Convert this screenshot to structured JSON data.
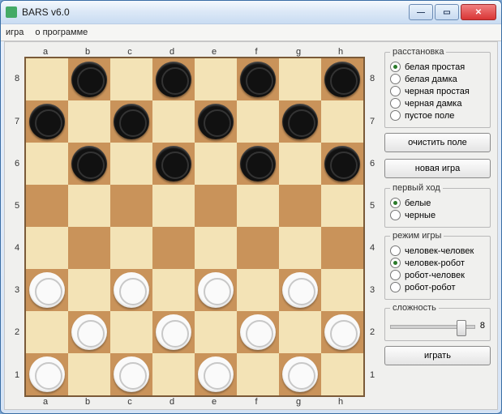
{
  "window": {
    "title": "BARS v6.0"
  },
  "menu": {
    "game": "игра",
    "about": "о программе"
  },
  "board": {
    "files": [
      "a",
      "b",
      "c",
      "d",
      "e",
      "f",
      "g",
      "h"
    ],
    "ranks": [
      "8",
      "7",
      "6",
      "5",
      "4",
      "3",
      "2",
      "1"
    ],
    "pieces": [
      {
        "r": 0,
        "c": 1,
        "color": "black"
      },
      {
        "r": 0,
        "c": 3,
        "color": "black"
      },
      {
        "r": 0,
        "c": 5,
        "color": "black"
      },
      {
        "r": 0,
        "c": 7,
        "color": "black"
      },
      {
        "r": 1,
        "c": 0,
        "color": "black"
      },
      {
        "r": 1,
        "c": 2,
        "color": "black"
      },
      {
        "r": 1,
        "c": 4,
        "color": "black"
      },
      {
        "r": 1,
        "c": 6,
        "color": "black"
      },
      {
        "r": 2,
        "c": 1,
        "color": "black"
      },
      {
        "r": 2,
        "c": 3,
        "color": "black"
      },
      {
        "r": 2,
        "c": 5,
        "color": "black"
      },
      {
        "r": 2,
        "c": 7,
        "color": "black"
      },
      {
        "r": 5,
        "c": 0,
        "color": "white"
      },
      {
        "r": 5,
        "c": 2,
        "color": "white"
      },
      {
        "r": 5,
        "c": 4,
        "color": "white"
      },
      {
        "r": 5,
        "c": 6,
        "color": "white"
      },
      {
        "r": 6,
        "c": 1,
        "color": "white"
      },
      {
        "r": 6,
        "c": 3,
        "color": "white"
      },
      {
        "r": 6,
        "c": 5,
        "color": "white"
      },
      {
        "r": 6,
        "c": 7,
        "color": "white"
      },
      {
        "r": 7,
        "c": 0,
        "color": "white"
      },
      {
        "r": 7,
        "c": 2,
        "color": "white"
      },
      {
        "r": 7,
        "c": 4,
        "color": "white"
      },
      {
        "r": 7,
        "c": 6,
        "color": "white"
      }
    ]
  },
  "setup": {
    "legend": "расстановка",
    "options": [
      {
        "label": "белая простая",
        "checked": true
      },
      {
        "label": "белая дамка",
        "checked": false
      },
      {
        "label": "черная простая",
        "checked": false
      },
      {
        "label": "черная дамка",
        "checked": false
      },
      {
        "label": "пустое поле",
        "checked": false
      }
    ]
  },
  "buttons": {
    "clear": "очистить поле",
    "newgame": "новая игра",
    "play": "играть"
  },
  "firstmove": {
    "legend": "первый ход",
    "options": [
      {
        "label": "белые",
        "checked": true
      },
      {
        "label": "черные",
        "checked": false
      }
    ]
  },
  "mode": {
    "legend": "режим игры",
    "options": [
      {
        "label": "человек-человек",
        "checked": false
      },
      {
        "label": "человек-робот",
        "checked": true
      },
      {
        "label": "робот-человек",
        "checked": false
      },
      {
        "label": "робот-робот",
        "checked": false
      }
    ]
  },
  "difficulty": {
    "legend": "сложность",
    "value": "8",
    "min": "1",
    "max": "10",
    "pos_pct": 78
  }
}
